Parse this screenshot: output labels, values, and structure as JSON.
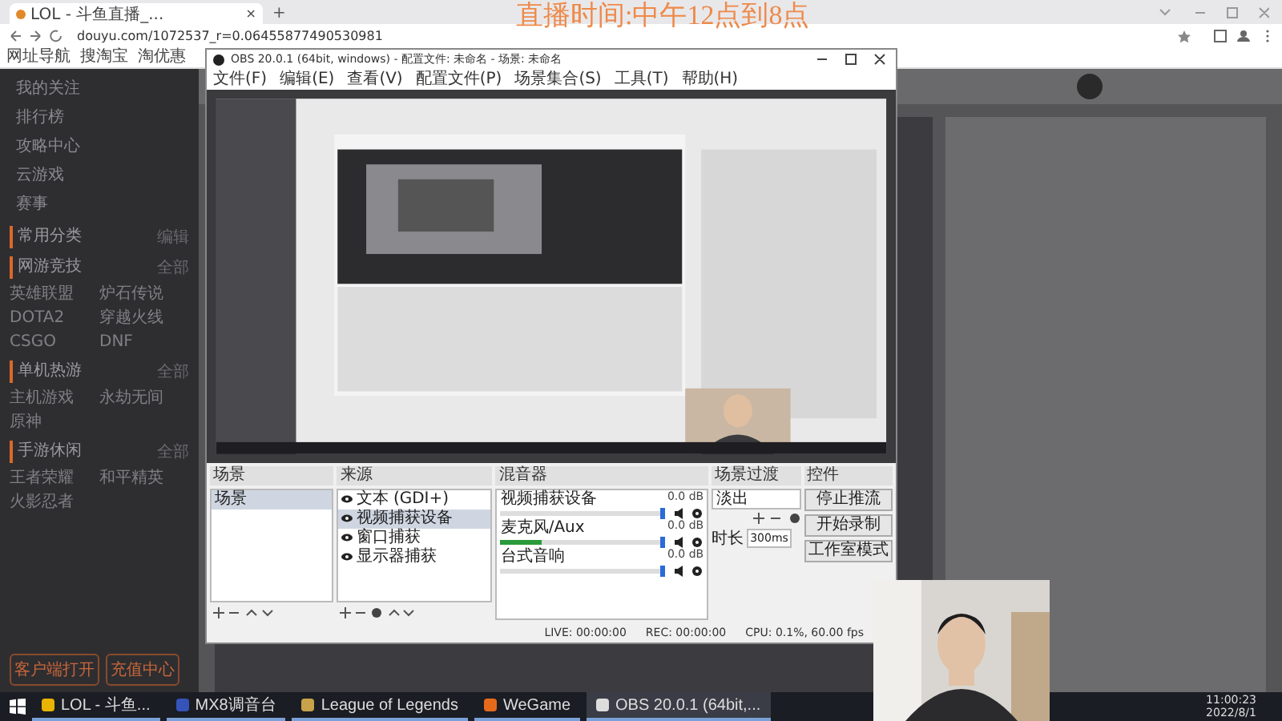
{
  "browser": {
    "tab": {
      "title": "LOL - 斗鱼直播_...",
      "close": "×"
    },
    "new_tab": "+",
    "url": "douyu.com/1072537_r=0.06455877490530981",
    "bookmarks": [
      "网址导航",
      "搜淘宝",
      "淘优惠"
    ]
  },
  "overlay_caption": "直播时间:中午12点到8点",
  "sidebar": {
    "nav": [
      "我的关注",
      "排行榜",
      "攻略中心",
      "云游戏",
      "赛事"
    ],
    "sections": [
      {
        "title": "常用分类",
        "more": "编辑"
      },
      {
        "title": "网游竞技",
        "more": "全部",
        "items": [
          "英雄联盟",
          "炉石传说",
          "DOTA2",
          "穿越火线",
          "CSGO",
          "DNF"
        ]
      },
      {
        "title": "单机热游",
        "more": "全部",
        "items": [
          "主机游戏",
          "永劫无间",
          "原神"
        ]
      },
      {
        "title": "手游休闲",
        "more": "全部",
        "items": [
          "王者荣耀",
          "和平精英",
          "火影忍者"
        ]
      }
    ],
    "buttons": [
      "客户端打开",
      "充值中心"
    ]
  },
  "obs": {
    "title": "OBS 20.0.1 (64bit, windows) - 配置文件: 未命名 - 场景: 未命名",
    "menu": [
      "文件(F)",
      "编辑(E)",
      "查看(V)",
      "配置文件(P)",
      "场景集合(S)",
      "工具(T)",
      "帮助(H)"
    ],
    "scenes": {
      "title": "场景",
      "items": [
        {
          "label": "场景",
          "selected": true
        }
      ]
    },
    "sources": {
      "title": "来源",
      "items": [
        {
          "label": "文本 (GDI+)",
          "selected": false
        },
        {
          "label": "视频捕获设备",
          "selected": true
        },
        {
          "label": "窗口捕获",
          "selected": false
        },
        {
          "label": "显示器捕获",
          "selected": false
        }
      ]
    },
    "mixer": {
      "title": "混音器",
      "channels": [
        {
          "name": "视频捕获设备",
          "reading": "0.0 dB",
          "level": 0,
          "fader": {
            "level": 1
          }
        },
        {
          "name": "麦克风/Aux",
          "reading": "0.0 dB",
          "level": 0.25,
          "fader": {
            "level": 1
          }
        },
        {
          "name": "台式音响",
          "reading": "0.0 dB",
          "level": 0,
          "fader": {
            "level": 1
          }
        }
      ]
    },
    "transitions": {
      "title": "场景过渡",
      "type": "淡出",
      "duration_label": "时长",
      "duration": "300ms"
    },
    "controls": {
      "title": "控件",
      "buttons": [
        "停止推流",
        "开始录制",
        "工作室模式"
      ]
    },
    "status": [
      "LIVE: 00:00:00",
      "REC: 00:00:00",
      "CPU: 0.1%, 60.00 fps"
    ]
  },
  "taskbar": {
    "items": [
      {
        "label": "LOL - 斗鱼...",
        "kind": "chrome",
        "selected": false
      },
      {
        "label": "MX8调音台",
        "kind": "mixer",
        "selected": false
      },
      {
        "label": "League of Legends",
        "kind": "lol",
        "selected": false
      },
      {
        "label": "WeGame",
        "kind": "wegame",
        "selected": false
      },
      {
        "label": "OBS 20.0.1 (64bit,...",
        "kind": "obs",
        "selected": true
      }
    ],
    "time": "11:00:23",
    "date": "2022/8/1"
  }
}
